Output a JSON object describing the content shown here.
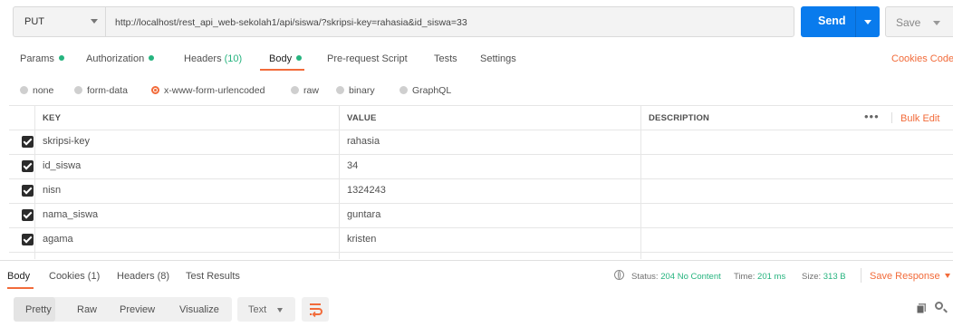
{
  "request": {
    "method": "PUT",
    "url": "http://localhost/rest_api_web-sekolah1/api/siswa/?skripsi-key=rahasia&id_siswa=33",
    "send_label": "Send",
    "save_label": "Save"
  },
  "request_tabs": {
    "params": "Params",
    "authorization": "Authorization",
    "headers": "Headers",
    "headers_count": "(10)",
    "body": "Body",
    "pre_request": "Pre-request Script",
    "tests": "Tests",
    "settings": "Settings",
    "cookies_code": "Cookies  Code"
  },
  "body_types": {
    "none": "none",
    "form_data": "form-data",
    "urlencoded": "x-www-form-urlencoded",
    "raw": "raw",
    "binary": "binary",
    "graphql": "GraphQL"
  },
  "table": {
    "headers": {
      "key": "KEY",
      "value": "VALUE",
      "description": "DESCRIPTION"
    },
    "more": "•••",
    "bulk_edit": "Bulk Edit",
    "rows": [
      {
        "key": "skripsi-key",
        "value": "rahasia"
      },
      {
        "key": "id_siswa",
        "value": "34"
      },
      {
        "key": "nisn",
        "value": "1324243"
      },
      {
        "key": "nama_siswa",
        "value": "guntara"
      },
      {
        "key": "agama",
        "value": "kristen"
      }
    ]
  },
  "response": {
    "tabs": {
      "body": "Body",
      "cookies": "Cookies (1)",
      "headers": "Headers (8)",
      "test_results": "Test Results"
    },
    "status_label": "Status:",
    "status_value": "204 No Content",
    "time_label": "Time:",
    "time_value": "201 ms",
    "size_label": "Size:",
    "size_value": "313 B",
    "save_response": "Save Response",
    "formats": {
      "pretty": "Pretty",
      "raw": "Raw",
      "preview": "Preview",
      "visualize": "Visualize"
    },
    "text_select": "Text"
  },
  "colors": {
    "accent": "#f26b3a",
    "send": "#097bed",
    "ok": "#26b47f"
  }
}
